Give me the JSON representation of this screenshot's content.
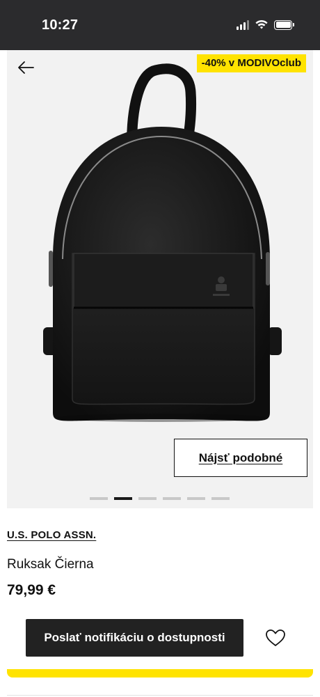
{
  "status_bar": {
    "time": "10:27",
    "icons": [
      "signal-icon",
      "wifi-icon",
      "battery-icon"
    ]
  },
  "gallery": {
    "promo_badge": "-40% v MODIVOclub",
    "find_similar_label": "Nájsť podobné",
    "image_count": 6,
    "active_index": 1,
    "image_subject": "black leather backpack",
    "icons": [
      "back-arrow-icon"
    ]
  },
  "product": {
    "brand": "U.S. POLO ASSN.",
    "name": "Ruksak Čierna",
    "price": "79,99 €"
  },
  "actions": {
    "notify_label": "Poslať notifikáciu o dostupnosti",
    "wishlist_icon": "heart-icon"
  },
  "colors": {
    "accent_yellow": "#ffe300",
    "dark": "#222222",
    "status_bar": "#2b2b2d"
  }
}
